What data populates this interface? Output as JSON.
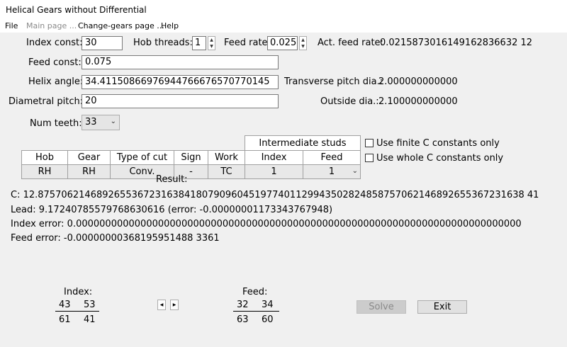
{
  "window": {
    "title": "Helical Gears without Differential"
  },
  "menu": [
    {
      "label": "File",
      "enabled": true
    },
    {
      "label": "Main page ...",
      "enabled": false
    },
    {
      "label": "Change-gears page ...",
      "enabled": true
    },
    {
      "label": "Help",
      "enabled": true
    }
  ],
  "form": {
    "index_const_label": "Index const:",
    "index_const_value": "30",
    "hob_threads_label": "Hob threads:",
    "hob_threads_value": "1",
    "feed_rate_label": "Feed rate:",
    "feed_rate_value": "0.025",
    "act_feed_rate_label": "Act. feed rate:",
    "act_feed_rate_value": "0.0215873016149162836632 12",
    "feed_const_label": "Feed const:",
    "feed_const_value": "0.075",
    "helix_angle_label": "Helix angle:",
    "helix_angle_value": "34.41150866976944766676570770145",
    "transverse_pitch_label": "Transverse pitch dia.:",
    "transverse_pitch_value": "2.000000000000",
    "diametral_pitch_label": "Diametral pitch:",
    "diametral_pitch_value": "20",
    "outside_dia_label": "Outside dia.:",
    "outside_dia_value": "2.100000000000",
    "num_teeth_label": "Num teeth:",
    "num_teeth_value": "33"
  },
  "grid": {
    "group_header": "Intermediate studs",
    "headers": [
      "Hob",
      "Gear",
      "Type of cut",
      "Sign",
      "Work",
      "Index",
      "Feed"
    ],
    "row": [
      "RH",
      "RH",
      "Conv.",
      "-",
      "TC",
      "1",
      "1"
    ]
  },
  "options": {
    "finite_c_label": "Use finite C constants only",
    "finite_c_checked": false,
    "whole_c_label": "Use whole C constants only",
    "whole_c_checked": false
  },
  "result": {
    "title": "Result:",
    "c_line": "C: 12.87570621468926553672316384180790960451977401129943502824858757062146892655367231638 41",
    "lead_line": "Lead: 9.17240785579768630616 (error: -0.00000001173343767948)",
    "index_error_line": "Index error: 0.0000000000000000000000000000000000000000000000000000000000000000000000000000",
    "feed_error_line": "Feed error: -0.00000000368195951488 3361"
  },
  "gears": {
    "index_label": "Index:",
    "index_top": [
      "43",
      "53"
    ],
    "index_bottom": [
      "61",
      "41"
    ],
    "feed_label": "Feed:",
    "feed_top": [
      "32",
      "34"
    ],
    "feed_bottom": [
      "63",
      "60"
    ]
  },
  "buttons": {
    "solve": "Solve",
    "exit": "Exit"
  }
}
